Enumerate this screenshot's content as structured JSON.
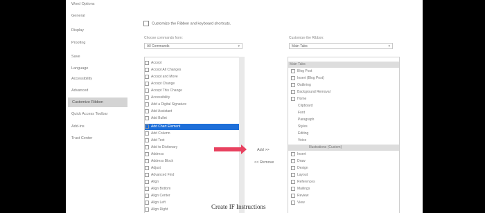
{
  "window": {
    "title": "Word Options"
  },
  "sidebar": {
    "items": [
      {
        "label": "General"
      },
      {
        "label": "Display"
      },
      {
        "label": "Proofing"
      },
      {
        "label": "Save"
      },
      {
        "label": "Language"
      },
      {
        "label": "Accessibility"
      },
      {
        "label": "Advanced"
      },
      {
        "label": "Customize Ribbon"
      },
      {
        "label": "Quick Access Toolbar"
      },
      {
        "label": "Add-ins"
      },
      {
        "label": "Trust Center"
      }
    ]
  },
  "main": {
    "heading": "Customize the Ribbon and keyboard shortcuts.",
    "left_label": "Choose commands from:",
    "left_combo": "All Commands",
    "right_label": "Customize the Ribbon:",
    "right_combo": "Main Tabs",
    "left_list": [
      "Accept",
      "Accept All Changes",
      "Accept and Move",
      "Accept Change",
      "Accept This Change",
      "Accessibility",
      "Add a Digital Signature",
      "Add Assistant",
      "Add Bullet",
      "Add Chart Element",
      "Add Column",
      "Add Text",
      "Add to Dictionary",
      "Address",
      "Address Block",
      "Adjust",
      "Advanced Find",
      "Align",
      "Align Bottom",
      "Align Center",
      "Align Left",
      "Align Right"
    ],
    "right_list": [
      "Main Tabs",
      "Blog Post",
      "Insert (Blog Post)",
      "Outlining",
      "Background Removal",
      "Home",
      "Clipboard",
      "Font",
      "Paragraph",
      "Styles",
      "Editing",
      "Voice",
      "Illustrations (Custom)",
      "Insert",
      "Draw",
      "Design",
      "Layout",
      "References",
      "Mailings",
      "Review",
      "View"
    ],
    "add_button": "Add >>",
    "remove_button": "<< Remove"
  },
  "caption": "Create IF Instructions"
}
